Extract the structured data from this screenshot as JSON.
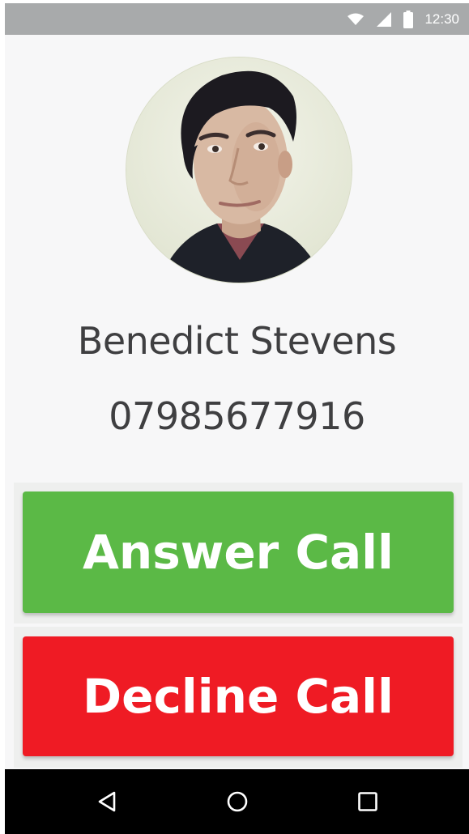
{
  "status_bar": {
    "time": "12:30",
    "icons": [
      "wifi-icon",
      "signal-icon",
      "battery-icon"
    ]
  },
  "caller": {
    "name": "Benedict Stevens",
    "number": "07985677916"
  },
  "actions": {
    "answer_label": "Answer Call",
    "decline_label": "Decline Call"
  },
  "navigation": {
    "icons": [
      "back-icon",
      "home-icon",
      "recents-icon"
    ]
  },
  "colors": {
    "answer": "#5bb946",
    "decline": "#ef1b24",
    "status_bar": "#a8aaab",
    "nav_bar": "#000000"
  }
}
